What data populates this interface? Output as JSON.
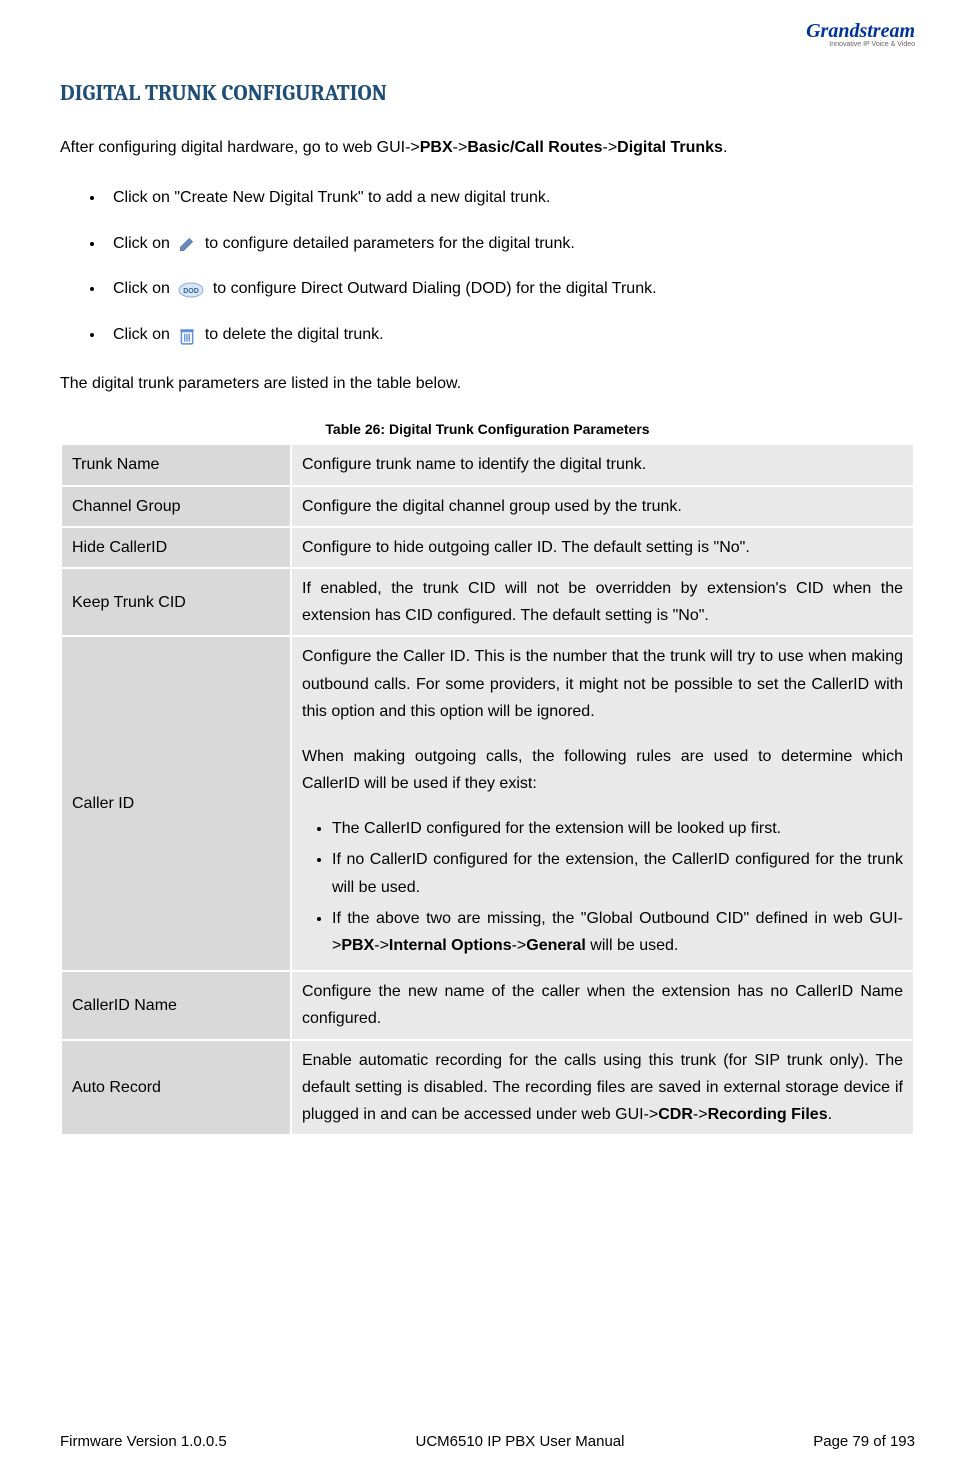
{
  "logo": {
    "brand": "Grandstream",
    "tagline": "Innovative IP Voice & Video"
  },
  "heading": "DIGITAL TRUNK CONFIGURATION",
  "intro": {
    "before_pbx": "After configuring digital hardware, go to web GUI->",
    "pbx": "PBX",
    "arrow1": "->",
    "basiccall": "Basic/Call Routes",
    "arrow2": "->",
    "digitaltrunks": "Digital Trunks",
    "end": "."
  },
  "bullets": {
    "b1": "Click on \"Create New Digital Trunk\" to add a new digital trunk.",
    "b2a": "Click on ",
    "b2b": " to configure detailed parameters for the digital trunk.",
    "b3a": "Click on ",
    "b3b": " to configure Direct Outward Dialing (DOD) for the digital Trunk.",
    "b4a": "Click on ",
    "b4b": " to delete the digital trunk."
  },
  "midpara": "The digital trunk parameters are listed in the table below.",
  "caption": "Table 26: Digital Trunk Configuration Parameters",
  "rows": {
    "r1": {
      "label": "Trunk Name",
      "desc": "Configure trunk name to identify the digital trunk."
    },
    "r2": {
      "label": "Channel Group",
      "desc": "Configure the digital channel group used by the trunk."
    },
    "r3": {
      "label": "Hide CallerID",
      "desc": "Configure to hide outgoing caller ID. The default setting is \"No\"."
    },
    "r4": {
      "label": "Keep Trunk CID",
      "desc": "If enabled, the trunk CID will not be overridden by extension's CID when the extension has CID configured. The default setting is \"No\"."
    },
    "r5": {
      "label": "Caller ID",
      "p1": "Configure the Caller ID. This is the number that the trunk will try to use when making outbound calls. For some providers, it might not be possible to set the CallerID with this option and this option will be ignored.",
      "p2": "When making outgoing calls, the following rules are used to determine which CallerID will be used if they exist:",
      "li1": "The CallerID configured for the extension will be looked up first.",
      "li2": "If no CallerID configured for the extension, the CallerID configured for the trunk will be used.",
      "li3a": "If the above two are missing, the \"Global Outbound CID\" defined in web GUI->",
      "li3_pbx": "PBX",
      "li3_arr1": "->",
      "li3_io": "Internal Options",
      "li3_arr2": "->",
      "li3_gen": "General",
      "li3b": " will be used."
    },
    "r6": {
      "label": "CallerID Name",
      "desc": "Configure the new name of the caller when the extension has no CallerID Name configured."
    },
    "r7": {
      "label": "Auto Record",
      "a": "Enable automatic recording for the calls using this trunk (for SIP trunk only). The default setting is disabled. The recording files are saved in external storage device if plugged in and can be accessed under web GUI->",
      "cdr": "CDR",
      "arr": "->",
      "rf": "Recording Files",
      "end": "."
    }
  },
  "footer": {
    "left": "Firmware Version 1.0.0.5",
    "center": "UCM6510 IP PBX User Manual",
    "right": "Page 79 of 193"
  }
}
